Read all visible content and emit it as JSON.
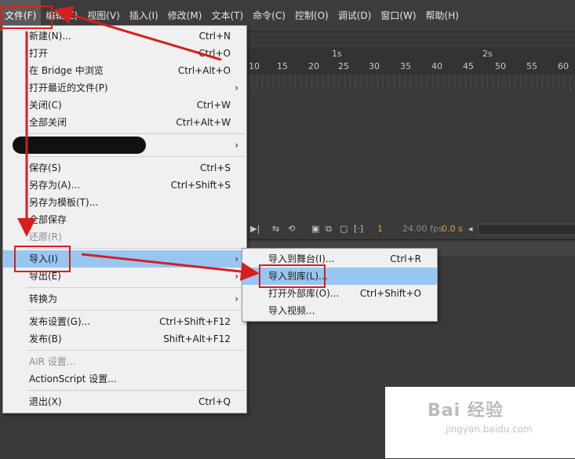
{
  "menubar": {
    "items": [
      "文件(F)",
      "编辑(E)",
      "视图(V)",
      "插入(I)",
      "修改(M)",
      "文本(T)",
      "命令(C)",
      "控制(O)",
      "调试(D)",
      "窗口(W)",
      "帮助(H)"
    ]
  },
  "timeline": {
    "seconds": [
      "1s",
      "2s"
    ],
    "frames": [
      "10",
      "15",
      "20",
      "25",
      "30",
      "35",
      "40",
      "45",
      "50",
      "55",
      "60"
    ],
    "fps": "24.00 fps",
    "time": "0.0 s",
    "frame": "1"
  },
  "file_menu": {
    "items": [
      {
        "label": "新建(N)...",
        "shortcut": "Ctrl+N"
      },
      {
        "label": "打开",
        "shortcut": "Ctrl+O"
      },
      {
        "label": "在 Bridge 中浏览",
        "shortcut": "Ctrl+Alt+O"
      },
      {
        "label": "打开最近的文件(P)",
        "shortcut": ""
      },
      {
        "label": "关闭(C)",
        "shortcut": "Ctrl+W"
      },
      {
        "label": "全部关闭",
        "shortcut": "Ctrl+Alt+W"
      },
      {
        "label": "保存(S)",
        "shortcut": "Ctrl+S"
      },
      {
        "label": "另存为(A)...",
        "shortcut": "Ctrl+Shift+S"
      },
      {
        "label": "另存为模板(T)...",
        "shortcut": ""
      },
      {
        "label": "全部保存",
        "shortcut": ""
      },
      {
        "label": "还原(R)",
        "shortcut": ""
      },
      {
        "label": "导入(I)",
        "shortcut": ""
      },
      {
        "label": "导出(E)",
        "shortcut": ""
      },
      {
        "label": "转换为",
        "shortcut": ""
      },
      {
        "label": "发布设置(G)...",
        "shortcut": "Ctrl+Shift+F12"
      },
      {
        "label": "发布(B)",
        "shortcut": "Shift+Alt+F12"
      },
      {
        "label": "AIR 设置...",
        "shortcut": ""
      },
      {
        "label": "ActionScript 设置...",
        "shortcut": ""
      },
      {
        "label": "退出(X)",
        "shortcut": "Ctrl+Q"
      }
    ]
  },
  "import_submenu": {
    "items": [
      {
        "label": "导入到舞台(I)...",
        "shortcut": "Ctrl+R"
      },
      {
        "label": "导入到库(L)...",
        "shortcut": ""
      },
      {
        "label": "打开外部库(O)...",
        "shortcut": "Ctrl+Shift+O"
      },
      {
        "label": "导入视频...",
        "shortcut": ""
      }
    ]
  },
  "watermark": {
    "text": "Bai 经验",
    "sub": "jingyan.baidu.com"
  },
  "colors": {
    "highlight": "#99c6f1",
    "annotation": "#d61f1f",
    "menu_bg": "#f0f0f0"
  }
}
